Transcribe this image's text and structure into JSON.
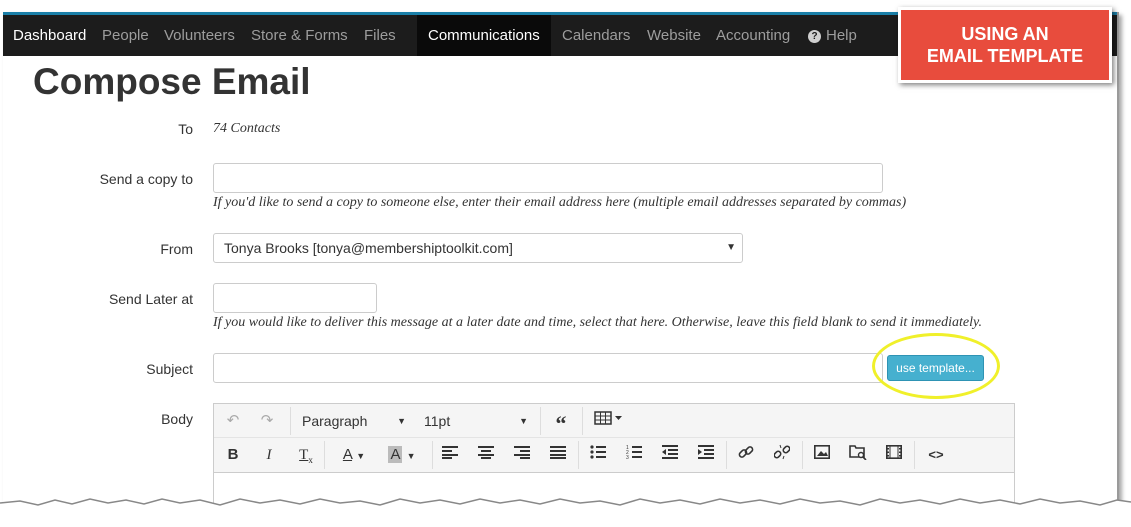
{
  "nav": {
    "items": [
      {
        "id": "dashboard",
        "label": "Dashboard"
      },
      {
        "id": "people",
        "label": "People"
      },
      {
        "id": "volunteers",
        "label": "Volunteers"
      },
      {
        "id": "store",
        "label": "Store & Forms"
      },
      {
        "id": "files",
        "label": "Files"
      },
      {
        "id": "communications",
        "label": "Communications"
      },
      {
        "id": "calendars",
        "label": "Calendars"
      },
      {
        "id": "website",
        "label": "Website"
      },
      {
        "id": "accounting",
        "label": "Accounting"
      },
      {
        "id": "help",
        "label": "Help"
      }
    ],
    "active": "Communications"
  },
  "callout": {
    "line1": "USING AN",
    "line2": "EMAIL TEMPLATE",
    "color": "#e84c3d"
  },
  "page": {
    "title": "Compose Email"
  },
  "form": {
    "to_label": "To",
    "to_value": "74 Contacts",
    "copy_label": "Send a copy to",
    "copy_value": "",
    "copy_help": "If you'd like to send a copy to someone else, enter their email address here (multiple email addresses separated by commas)",
    "from_label": "From",
    "from_value": "Tonya Brooks [tonya@membershiptoolkit.com]",
    "later_label": "Send Later at",
    "later_value": "",
    "later_help": "If you would like to deliver this message at a later date and time, select that here. Otherwise, leave this field blank to send it immediately.",
    "subject_label": "Subject",
    "subject_value": "",
    "template_button": "use template...",
    "body_label": "Body"
  },
  "editor": {
    "block_format": "Paragraph",
    "font_size": "11pt"
  },
  "colors": {
    "nav_bg": "#1c1c1c",
    "accent": "#46b0cf",
    "highlight": "#f0f02a"
  }
}
